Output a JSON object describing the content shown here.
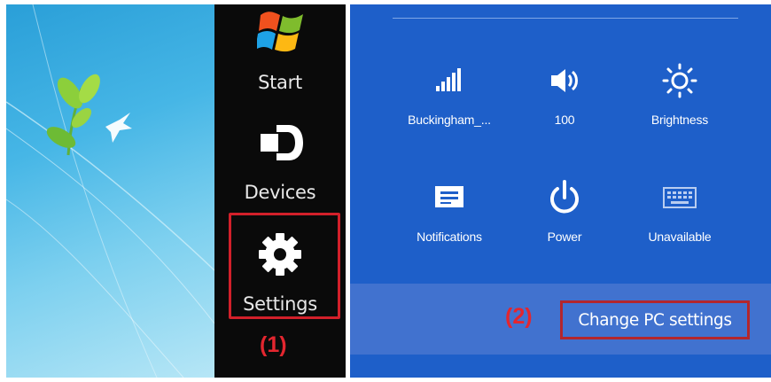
{
  "charms": {
    "start_label": "Start",
    "devices_label": "Devices",
    "settings_label": "Settings"
  },
  "settings_pane": {
    "tiles": [
      {
        "icon": "signal-bars-icon",
        "label": "Buckingham_..."
      },
      {
        "icon": "volume-icon",
        "label": "100"
      },
      {
        "icon": "brightness-icon",
        "label": "Brightness"
      },
      {
        "icon": "notifications-icon",
        "label": "Notifications"
      },
      {
        "icon": "power-icon",
        "label": "Power"
      },
      {
        "icon": "keyboard-icon",
        "label": "Unavailable"
      }
    ],
    "change_pc_settings_label": "Change PC settings"
  },
  "annotations": {
    "step1": "(1)",
    "step2": "(2)",
    "highlight_color": "#d2202a"
  },
  "colors": {
    "charms_bg": "#0a0a0a",
    "pane_bg": "#1e5fc9",
    "footer_bg": "#4172cf"
  }
}
